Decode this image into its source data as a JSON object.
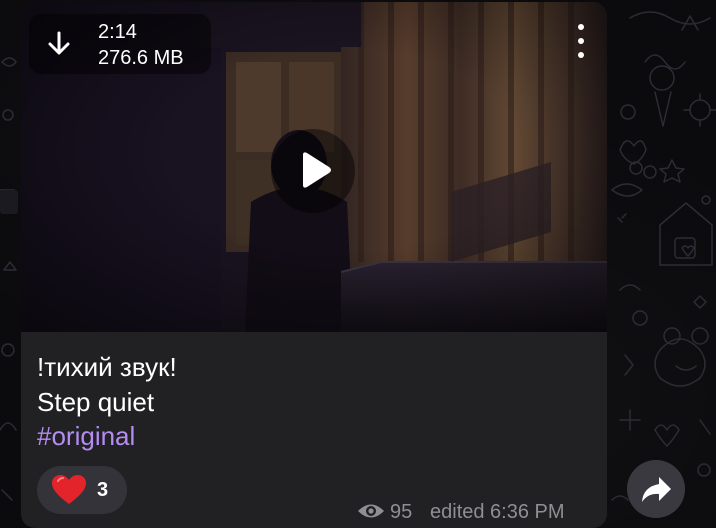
{
  "media": {
    "duration": "2:14",
    "file_size": "276.6 MB",
    "download_icon": "download-arrow-icon",
    "play_icon": "play-icon",
    "menu_icon": "more-vertical-icon"
  },
  "caption": {
    "line1": "!тихий звук!",
    "line2": "Step quiet",
    "hashtag": "#original"
  },
  "reaction": {
    "emoji_icon": "red-heart-icon",
    "count": "3"
  },
  "meta": {
    "views": "95",
    "edited_time": "edited 6:36 PM",
    "views_icon": "eye-icon"
  },
  "share": {
    "icon": "share-arrow-icon"
  },
  "colors": {
    "bubble": "#212124",
    "hashtag": "#b48cf2",
    "meta_text": "#8e8e93",
    "heart": "#e3242b",
    "wallpaper": "#0b0b0d"
  }
}
